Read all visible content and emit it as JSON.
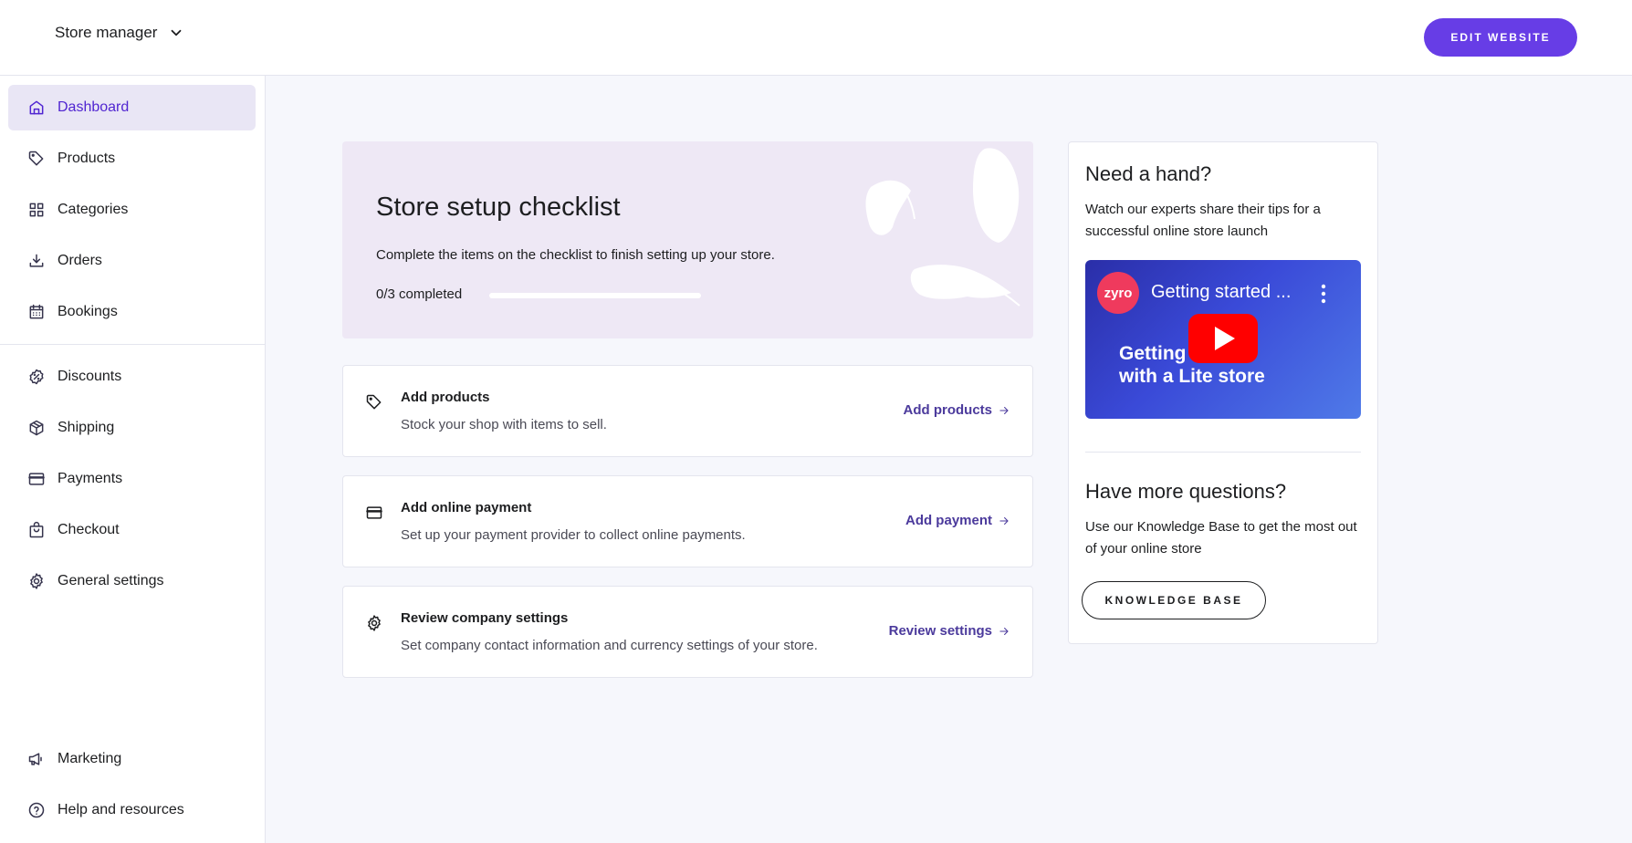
{
  "header": {
    "store_switcher_label": "Store manager",
    "edit_website_label": "EDIT WEBSITE"
  },
  "sidebar": {
    "items": [
      {
        "label": "Dashboard",
        "icon": "home-icon",
        "active": true
      },
      {
        "label": "Products",
        "icon": "tag-icon"
      },
      {
        "label": "Categories",
        "icon": "grid-icon"
      },
      {
        "label": "Orders",
        "icon": "download-icon"
      },
      {
        "label": "Bookings",
        "icon": "calendar-icon"
      },
      {
        "label": "Discounts",
        "icon": "discount-badge-icon"
      },
      {
        "label": "Shipping",
        "icon": "box-icon"
      },
      {
        "label": "Payments",
        "icon": "credit-card-icon"
      },
      {
        "label": "Checkout",
        "icon": "shopping-bag-icon"
      },
      {
        "label": "General settings",
        "icon": "gear-icon"
      },
      {
        "label": "Marketing",
        "icon": "megaphone-icon"
      },
      {
        "label": "Help and resources",
        "icon": "help-circle-icon"
      }
    ]
  },
  "checklist": {
    "title": "Store setup checklist",
    "description": "Complete the items on the checklist to finish setting up your store.",
    "progress_label": "0/3 completed",
    "completed": 0,
    "total": 3,
    "tasks": [
      {
        "title": "Add products",
        "description": "Stock your shop with items to sell.",
        "link": "Add products",
        "icon": "tag-icon"
      },
      {
        "title": "Add online payment",
        "description": "Set up your payment provider to collect online payments.",
        "link": "Add payment",
        "icon": "credit-card-icon"
      },
      {
        "title": "Review company settings",
        "description": "Set company contact information and currency settings of your store.",
        "link": "Review settings",
        "icon": "gear-icon"
      }
    ]
  },
  "help": {
    "title": "Need a hand?",
    "description": "Watch our experts share their tips for a successful online store launch",
    "video": {
      "channel": "zyro",
      "title": "Getting started ...",
      "overlay_line1": "Getting",
      "overlay_line2": "with a Lite store"
    },
    "questions_title": "Have more questions?",
    "questions_description": "Use our Knowledge Base to get the most out of your online store",
    "kb_button_label": "KNOWLEDGE BASE"
  },
  "colors": {
    "accent": "#673de6",
    "active_nav_bg": "#e9e6f5",
    "active_nav_text": "#5025d1",
    "hero_bg": "#eee8f5",
    "link": "#4b3a9c",
    "youtube_red": "#ff0000",
    "zyro_logo": "#ef3a5d"
  }
}
